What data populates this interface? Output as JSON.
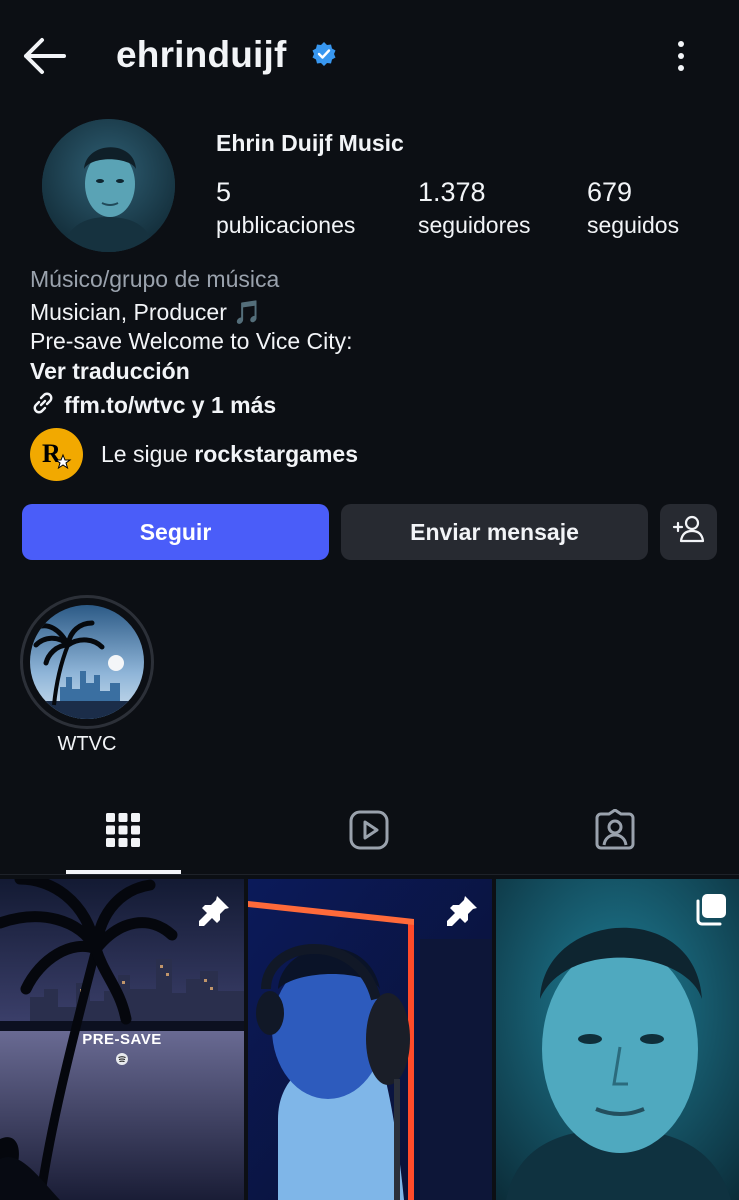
{
  "header": {
    "username": "ehrinduijf"
  },
  "profile": {
    "display_name": "Ehrin Duijf Music",
    "stats": [
      {
        "value": "5",
        "label": "publicaciones"
      },
      {
        "value": "1.378",
        "label": "seguidores"
      },
      {
        "value": "679",
        "label": "seguidos"
      }
    ],
    "category": "Músico/grupo de música",
    "bio_line1": "Musician, Producer 🎵",
    "bio_line2": "Pre-save Welcome to Vice City:",
    "translate_label": "Ver traducción",
    "link_text": "ffm.to/wtvc y 1 más",
    "followed_by_prefix": "Le sigue ",
    "followed_by_user": "rockstargames"
  },
  "buttons": {
    "follow": "Seguir",
    "message": "Enviar mensaje"
  },
  "highlights": [
    {
      "label": "WTVC"
    }
  ],
  "posts": [
    {
      "overlay_text": "PRE-SAVE",
      "badge": "pin-icon"
    },
    {
      "badge": "pin-icon"
    },
    {
      "badge": "carousel-icon"
    }
  ],
  "colors": {
    "background": "#0c0f14",
    "follow_button": "#4a5df9",
    "secondary_button": "#272a31",
    "verified": "#3897f0",
    "rockstar_yellow": "#f2a900"
  }
}
